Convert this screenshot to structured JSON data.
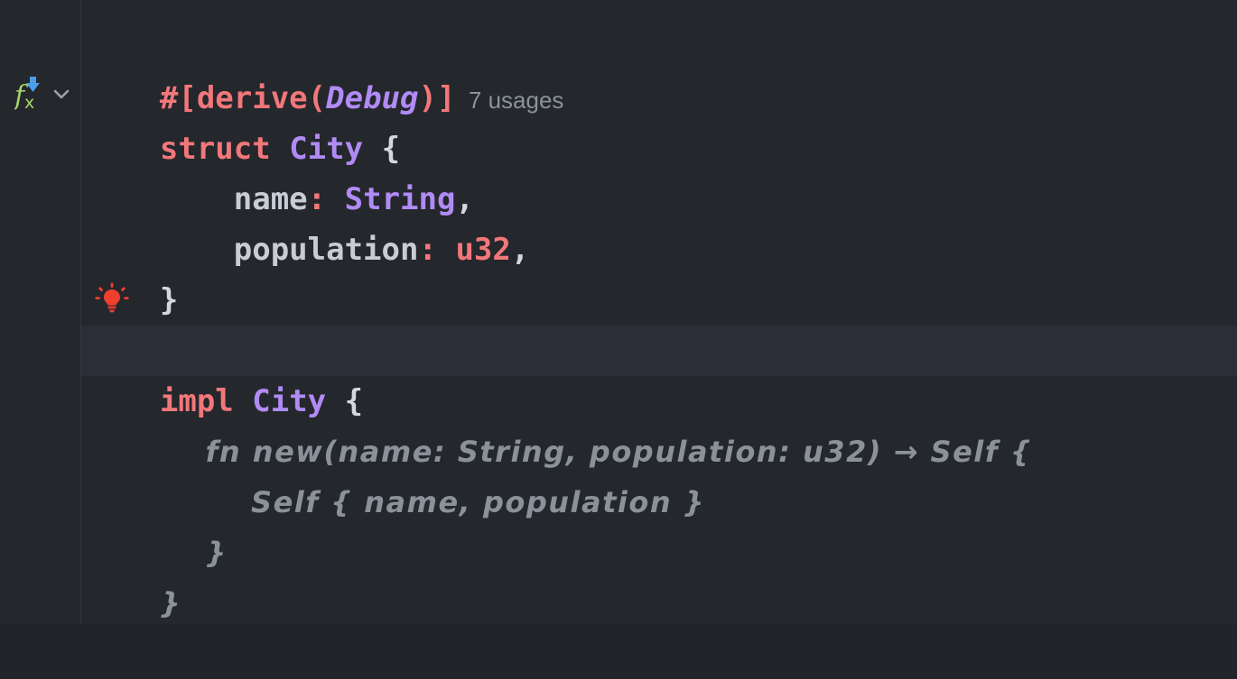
{
  "editor": {
    "theme": "dark",
    "background": "#24272c",
    "gutter_background": "#24272c",
    "gutter_divider_color": "#33373d",
    "caret_line_background": "#2b2e37",
    "language": "Rust"
  },
  "gutter": {
    "icons": [
      {
        "name": "fx-implementation-icon",
        "glyph": "fx",
        "color": "#a5d36a",
        "badge_color": "#4a9eea",
        "line": 2
      },
      {
        "name": "chevron-down-icon",
        "glyph": "⌄",
        "color": "#9ba1a9",
        "line": 2
      },
      {
        "name": "intention-bulb-icon",
        "glyph": "bulb",
        "color": "#f03e2f",
        "line": 6
      }
    ]
  },
  "inlay_hints": [
    {
      "text": "7 usages",
      "color": "#8b9299",
      "line": 1
    }
  ],
  "code_lines": [
    {
      "line": 1,
      "kind": "code",
      "tokens": [
        {
          "text": "#[derive(",
          "class": "attr"
        },
        {
          "text": "Debug",
          "class": "type-i"
        },
        {
          "text": ")]",
          "class": "attr"
        }
      ]
    },
    {
      "line": 2,
      "kind": "code",
      "tokens": [
        {
          "text": "struct",
          "class": "kw"
        },
        {
          "text": " ",
          "class": "punc"
        },
        {
          "text": "City",
          "class": "type"
        },
        {
          "text": " ",
          "class": "punc"
        },
        {
          "text": "{",
          "class": "punc"
        }
      ]
    },
    {
      "line": 3,
      "kind": "code",
      "tokens": [
        {
          "text": "    name",
          "class": "ident"
        },
        {
          "text": ":",
          "class": "colon"
        },
        {
          "text": " ",
          "class": "punc"
        },
        {
          "text": "String",
          "class": "type"
        },
        {
          "text": ",",
          "class": "punc"
        }
      ]
    },
    {
      "line": 4,
      "kind": "code",
      "tokens": [
        {
          "text": "    population",
          "class": "ident"
        },
        {
          "text": ":",
          "class": "colon"
        },
        {
          "text": " ",
          "class": "punc"
        },
        {
          "text": "u32",
          "class": "prim"
        },
        {
          "text": ",",
          "class": "punc"
        }
      ]
    },
    {
      "line": 5,
      "kind": "code",
      "tokens": [
        {
          "text": "}",
          "class": "punc"
        }
      ]
    },
    {
      "line": 6,
      "kind": "blank",
      "tokens": []
    },
    {
      "line": 7,
      "kind": "code",
      "highlighted": true,
      "tokens": [
        {
          "text": "impl",
          "class": "kw"
        },
        {
          "text": " ",
          "class": "punc"
        },
        {
          "text": "City",
          "class": "type"
        },
        {
          "text": " ",
          "class": "punc"
        },
        {
          "text": "{",
          "class": "punc"
        }
      ]
    },
    {
      "line": 8,
      "kind": "ghost",
      "text": "    fn new(name: String, population: u32) → Self {"
    },
    {
      "line": 9,
      "kind": "ghost",
      "text": "        Self { name, population }"
    },
    {
      "line": 10,
      "kind": "ghost",
      "text": "    }"
    },
    {
      "line": 11,
      "kind": "ghost",
      "text": "}"
    }
  ],
  "colors": {
    "keyword": "#f2777a",
    "type": "#b18bf5",
    "identifier": "#c8ccd4",
    "punctuation": "#d4d7dd",
    "ghost_text": "#8a9199",
    "inlay_hint": "#8b9299",
    "bulb": "#f03e2f",
    "fx_green": "#a5d36a",
    "badge_blue": "#4a9eea"
  }
}
